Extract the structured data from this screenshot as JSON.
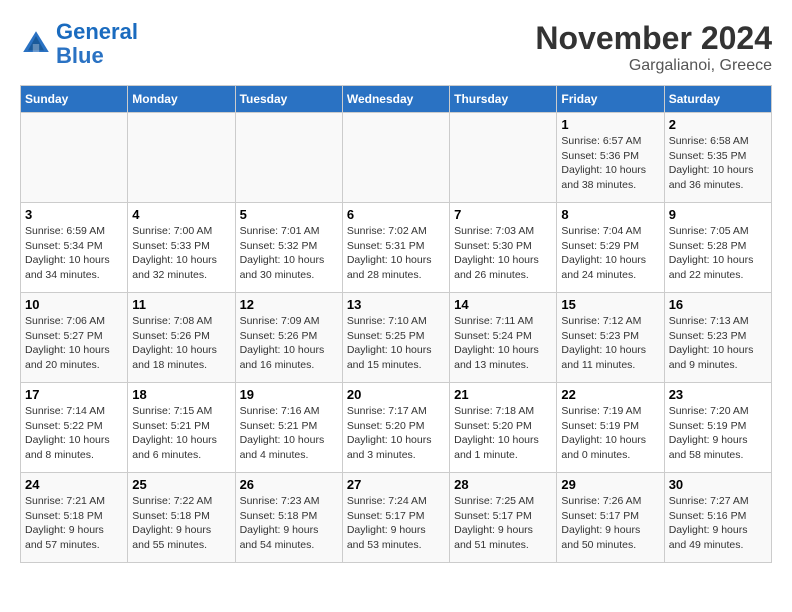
{
  "logo": {
    "line1": "General",
    "line2": "Blue"
  },
  "title": "November 2024",
  "subtitle": "Gargalianoi, Greece",
  "days_of_week": [
    "Sunday",
    "Monday",
    "Tuesday",
    "Wednesday",
    "Thursday",
    "Friday",
    "Saturday"
  ],
  "weeks": [
    [
      {
        "day": "",
        "info": ""
      },
      {
        "day": "",
        "info": ""
      },
      {
        "day": "",
        "info": ""
      },
      {
        "day": "",
        "info": ""
      },
      {
        "day": "",
        "info": ""
      },
      {
        "day": "1",
        "info": "Sunrise: 6:57 AM\nSunset: 5:36 PM\nDaylight: 10 hours\nand 38 minutes."
      },
      {
        "day": "2",
        "info": "Sunrise: 6:58 AM\nSunset: 5:35 PM\nDaylight: 10 hours\nand 36 minutes."
      }
    ],
    [
      {
        "day": "3",
        "info": "Sunrise: 6:59 AM\nSunset: 5:34 PM\nDaylight: 10 hours\nand 34 minutes."
      },
      {
        "day": "4",
        "info": "Sunrise: 7:00 AM\nSunset: 5:33 PM\nDaylight: 10 hours\nand 32 minutes."
      },
      {
        "day": "5",
        "info": "Sunrise: 7:01 AM\nSunset: 5:32 PM\nDaylight: 10 hours\nand 30 minutes."
      },
      {
        "day": "6",
        "info": "Sunrise: 7:02 AM\nSunset: 5:31 PM\nDaylight: 10 hours\nand 28 minutes."
      },
      {
        "day": "7",
        "info": "Sunrise: 7:03 AM\nSunset: 5:30 PM\nDaylight: 10 hours\nand 26 minutes."
      },
      {
        "day": "8",
        "info": "Sunrise: 7:04 AM\nSunset: 5:29 PM\nDaylight: 10 hours\nand 24 minutes."
      },
      {
        "day": "9",
        "info": "Sunrise: 7:05 AM\nSunset: 5:28 PM\nDaylight: 10 hours\nand 22 minutes."
      }
    ],
    [
      {
        "day": "10",
        "info": "Sunrise: 7:06 AM\nSunset: 5:27 PM\nDaylight: 10 hours\nand 20 minutes."
      },
      {
        "day": "11",
        "info": "Sunrise: 7:08 AM\nSunset: 5:26 PM\nDaylight: 10 hours\nand 18 minutes."
      },
      {
        "day": "12",
        "info": "Sunrise: 7:09 AM\nSunset: 5:26 PM\nDaylight: 10 hours\nand 16 minutes."
      },
      {
        "day": "13",
        "info": "Sunrise: 7:10 AM\nSunset: 5:25 PM\nDaylight: 10 hours\nand 15 minutes."
      },
      {
        "day": "14",
        "info": "Sunrise: 7:11 AM\nSunset: 5:24 PM\nDaylight: 10 hours\nand 13 minutes."
      },
      {
        "day": "15",
        "info": "Sunrise: 7:12 AM\nSunset: 5:23 PM\nDaylight: 10 hours\nand 11 minutes."
      },
      {
        "day": "16",
        "info": "Sunrise: 7:13 AM\nSunset: 5:23 PM\nDaylight: 10 hours\nand 9 minutes."
      }
    ],
    [
      {
        "day": "17",
        "info": "Sunrise: 7:14 AM\nSunset: 5:22 PM\nDaylight: 10 hours\nand 8 minutes."
      },
      {
        "day": "18",
        "info": "Sunrise: 7:15 AM\nSunset: 5:21 PM\nDaylight: 10 hours\nand 6 minutes."
      },
      {
        "day": "19",
        "info": "Sunrise: 7:16 AM\nSunset: 5:21 PM\nDaylight: 10 hours\nand 4 minutes."
      },
      {
        "day": "20",
        "info": "Sunrise: 7:17 AM\nSunset: 5:20 PM\nDaylight: 10 hours\nand 3 minutes."
      },
      {
        "day": "21",
        "info": "Sunrise: 7:18 AM\nSunset: 5:20 PM\nDaylight: 10 hours\nand 1 minute."
      },
      {
        "day": "22",
        "info": "Sunrise: 7:19 AM\nSunset: 5:19 PM\nDaylight: 10 hours\nand 0 minutes."
      },
      {
        "day": "23",
        "info": "Sunrise: 7:20 AM\nSunset: 5:19 PM\nDaylight: 9 hours\nand 58 minutes."
      }
    ],
    [
      {
        "day": "24",
        "info": "Sunrise: 7:21 AM\nSunset: 5:18 PM\nDaylight: 9 hours\nand 57 minutes."
      },
      {
        "day": "25",
        "info": "Sunrise: 7:22 AM\nSunset: 5:18 PM\nDaylight: 9 hours\nand 55 minutes."
      },
      {
        "day": "26",
        "info": "Sunrise: 7:23 AM\nSunset: 5:18 PM\nDaylight: 9 hours\nand 54 minutes."
      },
      {
        "day": "27",
        "info": "Sunrise: 7:24 AM\nSunset: 5:17 PM\nDaylight: 9 hours\nand 53 minutes."
      },
      {
        "day": "28",
        "info": "Sunrise: 7:25 AM\nSunset: 5:17 PM\nDaylight: 9 hours\nand 51 minutes."
      },
      {
        "day": "29",
        "info": "Sunrise: 7:26 AM\nSunset: 5:17 PM\nDaylight: 9 hours\nand 50 minutes."
      },
      {
        "day": "30",
        "info": "Sunrise: 7:27 AM\nSunset: 5:16 PM\nDaylight: 9 hours\nand 49 minutes."
      }
    ]
  ]
}
